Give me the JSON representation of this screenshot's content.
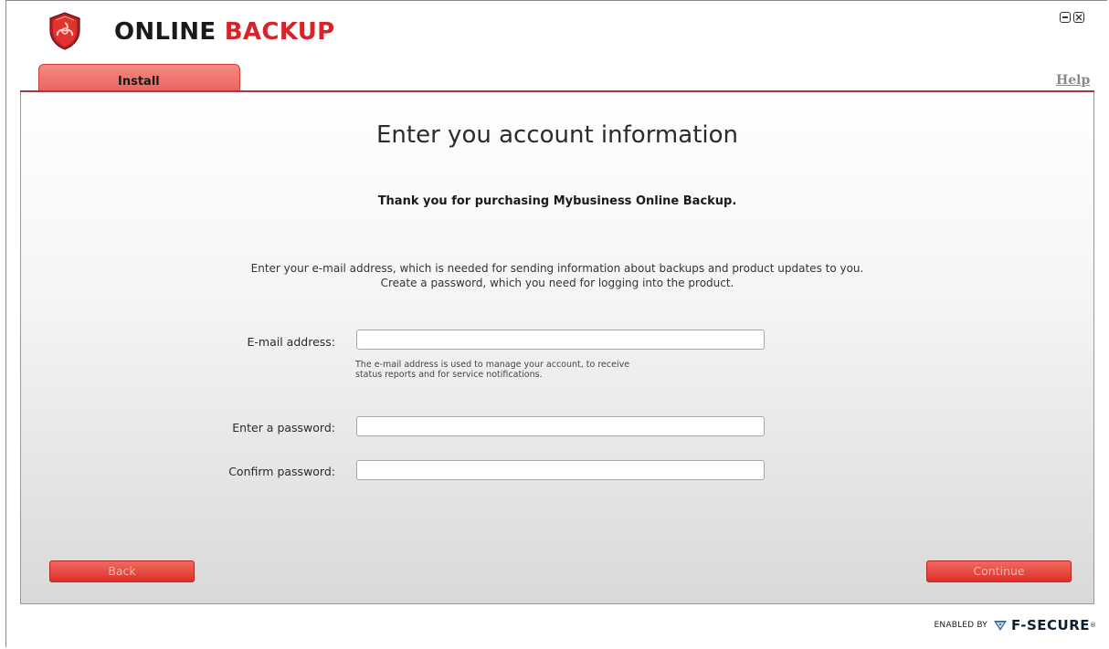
{
  "header": {
    "title_part1": "ONLINE",
    "title_part2": "BACKUP",
    "logo_icon": "shield-biohazard-icon",
    "window_controls": [
      "minimize-icon",
      "close-icon"
    ]
  },
  "tabs": [
    {
      "label": "Install",
      "active": true
    }
  ],
  "help_link": "Help",
  "main": {
    "heading": "Enter you account information",
    "thanks": "Thank you for purchasing Mybusiness Online Backup.",
    "intro_line1": "Enter your e-mail address, which is needed for sending information about backups and product updates to you.",
    "intro_line2": "Create a password, which you need for logging into the product."
  },
  "form": {
    "email_label": "E-mail address:",
    "email_value": "",
    "email_hint_line1": "The e-mail address is used to manage your account, to receive",
    "email_hint_line2": "status reports and for service notifications.",
    "password_label": "Enter a password:",
    "password_value": "",
    "confirm_label": "Confirm password:",
    "confirm_value": ""
  },
  "buttons": {
    "back": "Back",
    "continue": "Continue"
  },
  "footer": {
    "enabled_by": "ENABLED BY",
    "brand": "F-SECURE",
    "brand_mark": "®"
  },
  "colors": {
    "accent_red": "#d3262a",
    "tab_fill": "#ee776f",
    "divider": "#a33a3f"
  }
}
